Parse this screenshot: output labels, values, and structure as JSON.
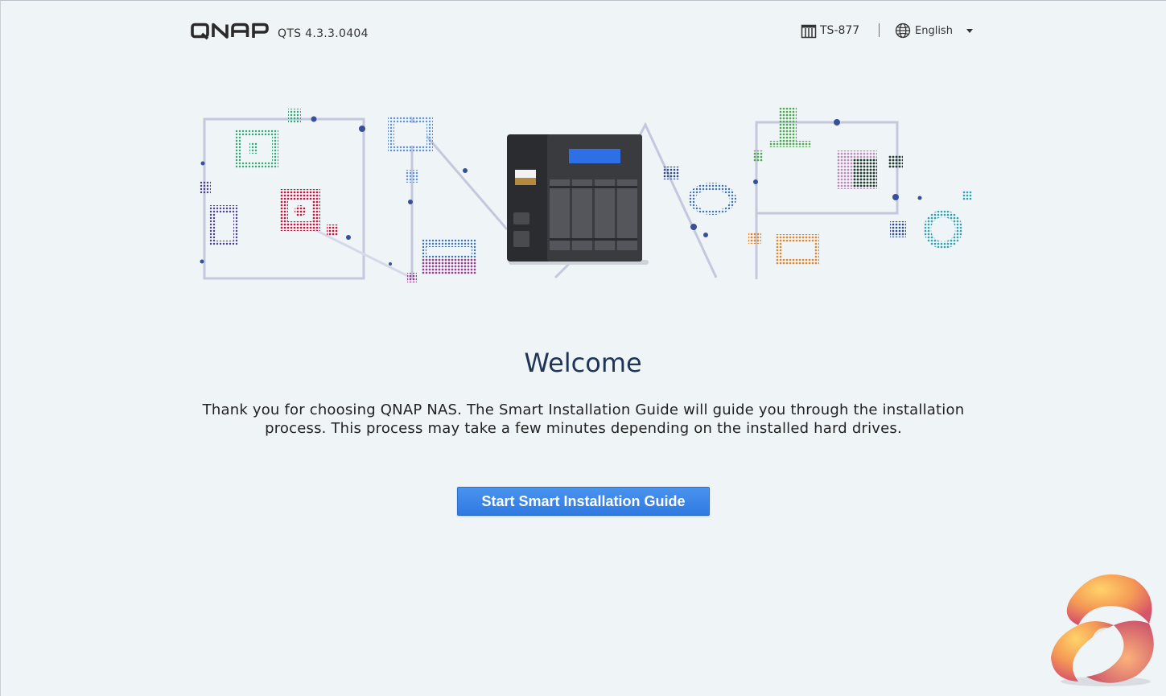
{
  "header": {
    "brand": "QNAP",
    "version": "QTS 4.3.3.0404",
    "model": "TS-877",
    "language": "English"
  },
  "icons": {
    "model": "nas-device-icon",
    "language": "globe-icon",
    "dropdown": "caret-down-icon",
    "corner": "watermark-logo-icon"
  },
  "main": {
    "title": "Welcome",
    "description": "Thank you for choosing QNAP NAS. The Smart Installation Guide will guide you through the installation process. This process may take a few minutes depending on the installed hard drives.",
    "start_button": "Start Smart Installation Guide"
  },
  "colors": {
    "background": "#eff4f7",
    "title": "#1f3456",
    "button": "#3b86ea",
    "button_text": "#ffffff",
    "nas_screen": "#2f6fe6"
  }
}
